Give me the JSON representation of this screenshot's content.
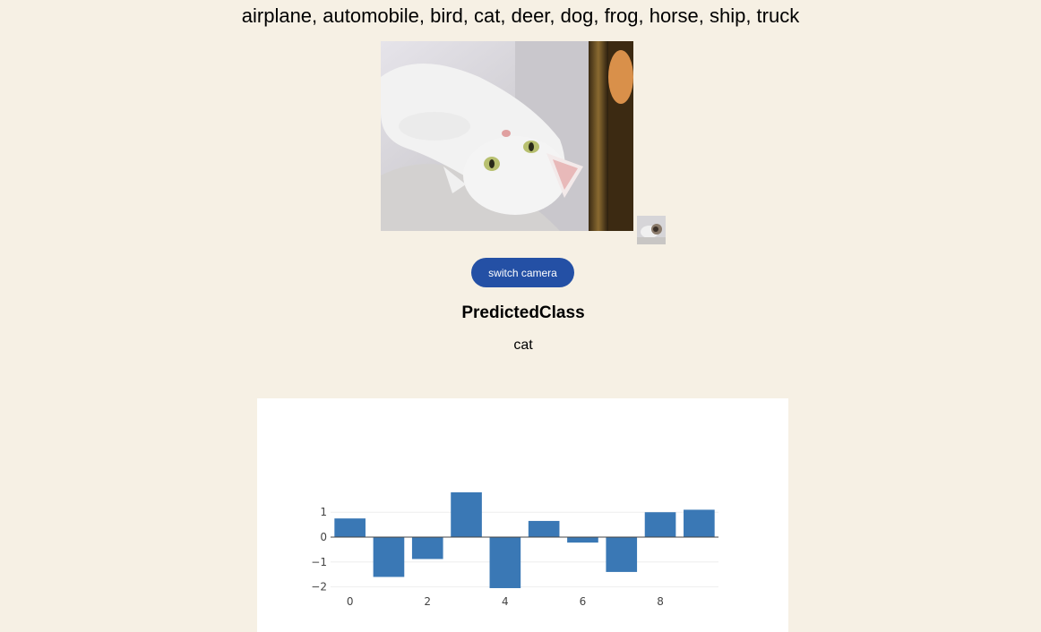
{
  "header": {
    "classes_text": "airplane, automobile, bird, cat, deer, dog, frog, horse, ship, truck"
  },
  "camera": {
    "switch_label": "switch camera"
  },
  "prediction": {
    "title": "PredictedClass",
    "value": "cat"
  },
  "colors": {
    "background": "#f6f0e4",
    "button": "#2450a5",
    "bar": "#3a78b5"
  },
  "chart_data": {
    "type": "bar",
    "categories": [
      0,
      1,
      2,
      3,
      4,
      5,
      6,
      7,
      8,
      9
    ],
    "values": [
      0.75,
      -1.6,
      -0.88,
      1.8,
      -2.05,
      0.65,
      -0.22,
      -1.4,
      1.0,
      1.1
    ],
    "xticks": [
      "0",
      "2",
      "4",
      "6",
      "8"
    ],
    "yticks": [
      "1",
      "0",
      "−1",
      "−2"
    ],
    "ylim": [
      -2.1,
      1.85
    ],
    "grid": true,
    "title": "",
    "xlabel": "",
    "ylabel": ""
  }
}
